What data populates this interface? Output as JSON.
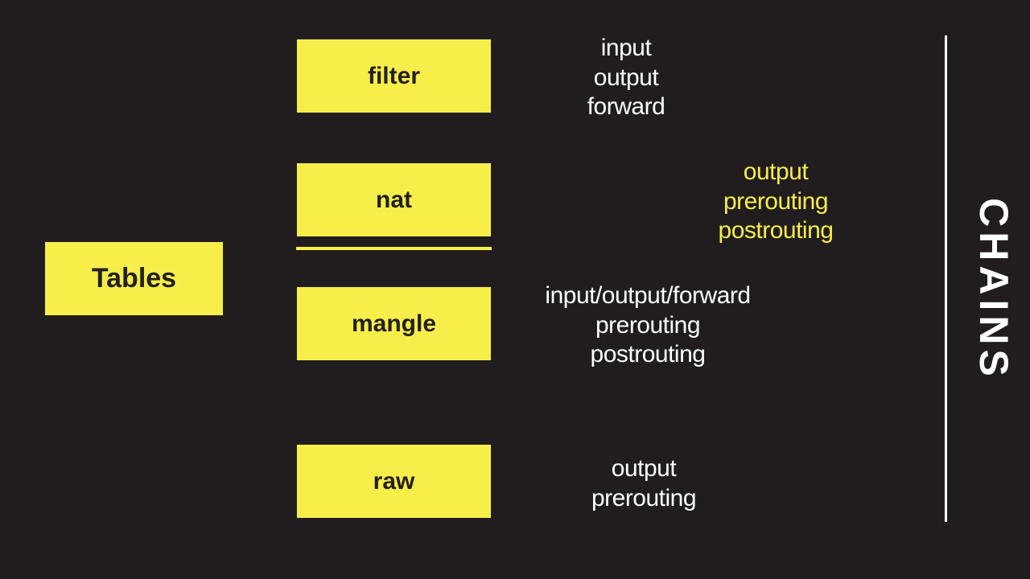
{
  "root_label": "Tables",
  "sidebar_label": "CHAINS",
  "tables": {
    "filter": {
      "name": "filter",
      "chains_text": "input\noutput\nforward",
      "highlighted": false
    },
    "nat": {
      "name": "nat",
      "chains_text": "output\nprerouting\npostrouting",
      "highlighted": true
    },
    "mangle": {
      "name": "mangle",
      "chains_text": "input/output/forward\nprerouting\npostrouting",
      "highlighted": false
    },
    "raw": {
      "name": "raw",
      "chains_text": "output\nprerouting",
      "highlighted": false
    }
  },
  "colors": {
    "background": "#211d1e",
    "box_fill": "#f8ee49",
    "box_text": "#232020",
    "text": "#ffffff",
    "highlight_text": "#f8ee49"
  }
}
